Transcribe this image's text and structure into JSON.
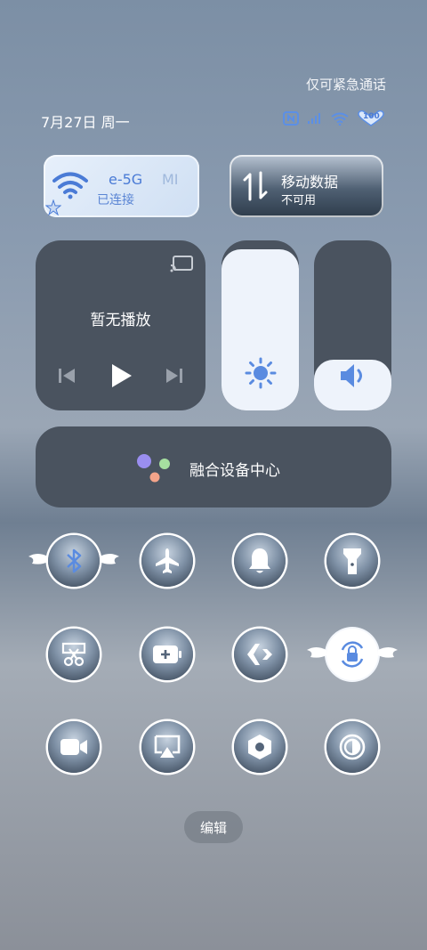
{
  "header": {
    "emergency_text": "仅可紧急通话",
    "date_text": "7月27日 周一",
    "battery": "100"
  },
  "tiles": {
    "wifi": {
      "ssid_visible": "e-5G",
      "ssid_tail": "MI",
      "status": "已连接"
    },
    "mobile_data": {
      "title": "移动数据",
      "status": "不可用"
    }
  },
  "media": {
    "title": "暂无播放"
  },
  "sliders": {
    "brightness": {
      "level": 0.95
    },
    "volume": {
      "level": 0.3
    }
  },
  "fusion": {
    "label": "融合设备中心"
  },
  "toggles": [
    {
      "name": "bluetooth-toggle",
      "icon": "bluetooth-icon",
      "active": true
    },
    {
      "name": "airplane-toggle",
      "icon": "airplane-icon",
      "active": false
    },
    {
      "name": "ringer-toggle",
      "icon": "bell-icon",
      "active": false
    },
    {
      "name": "flashlight-toggle",
      "icon": "flashlight-icon",
      "active": false
    },
    {
      "name": "screenshot-toggle",
      "icon": "scissors-icon",
      "active": false
    },
    {
      "name": "battery-saver-toggle",
      "icon": "battery-plus-icon",
      "active": false
    },
    {
      "name": "nearby-share-toggle",
      "icon": "share-arrows-icon",
      "active": false
    },
    {
      "name": "rotation-lock-toggle",
      "icon": "rotation-lock-icon",
      "active": true
    },
    {
      "name": "screen-record-toggle",
      "icon": "video-camera-icon",
      "active": false
    },
    {
      "name": "screen-cast-toggle",
      "icon": "cast-screen-icon",
      "active": false
    },
    {
      "name": "settings-toggle",
      "icon": "hexagon-settings-icon",
      "active": false
    },
    {
      "name": "dark-mode-toggle",
      "icon": "dark-mode-icon",
      "active": false
    }
  ],
  "edit": {
    "label": "编辑"
  },
  "colors": {
    "accent": "#5a8be0",
    "panel": "#4a535f",
    "fill": "#eef3fb"
  }
}
